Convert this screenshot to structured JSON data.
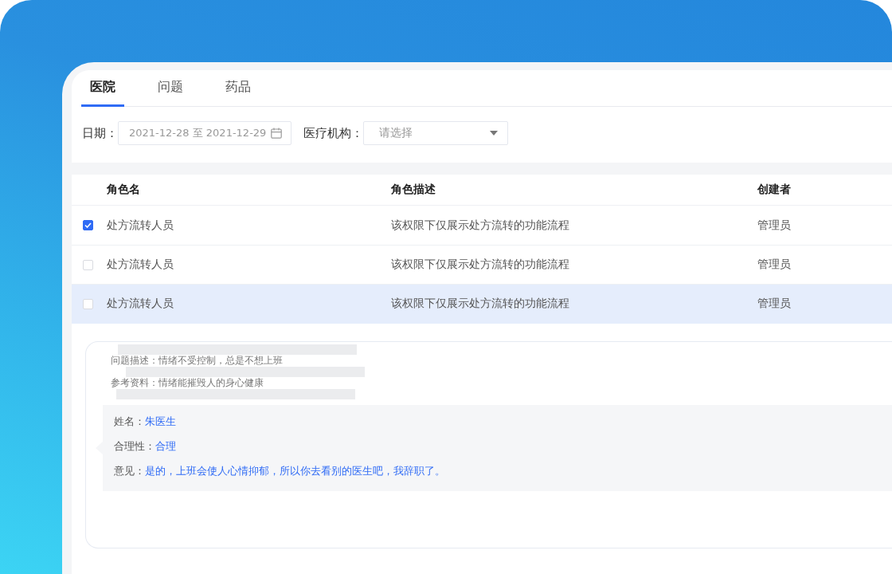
{
  "tabs": [
    {
      "label": "医院",
      "selected": true
    },
    {
      "label": "问题",
      "selected": false
    },
    {
      "label": "药品",
      "selected": false
    }
  ],
  "filters": [
    {
      "kind": "date_range",
      "label": "日期：",
      "value": "2021-12-28 至 2021-12-29"
    },
    {
      "kind": "select",
      "label": "医疗机构：",
      "placeholder": "请选择"
    }
  ],
  "table": {
    "columns": [
      "角色名",
      "角色描述",
      "创建者"
    ],
    "rows": [
      {
        "checked": true,
        "highlighted": false,
        "cells": [
          "处方流转人员",
          "该权限下仅展示处方流转的功能流程",
          "管理员"
        ]
      },
      {
        "checked": false,
        "highlighted": false,
        "cells": [
          "处方流转人员",
          "该权限下仅展示处方流转的功能流程",
          "管理员"
        ]
      },
      {
        "checked": false,
        "highlighted": true,
        "cells": [
          "处方流转人员",
          "该权限下仅展示处方流转的功能流程",
          "管理员"
        ]
      }
    ]
  },
  "detail": {
    "lines": [
      "问题描述：情绪不受控制，总是不想上班",
      "参考资料：情绪能摧毁人的身心健康"
    ],
    "review": [
      {
        "label": "姓名：",
        "value": "朱医生"
      },
      {
        "label": "合理性：",
        "value": "合理"
      },
      {
        "label": "意见：",
        "value": "是的，上班会使人心情抑郁，所以你去看别的医生吧，我辞职了。"
      }
    ]
  }
}
